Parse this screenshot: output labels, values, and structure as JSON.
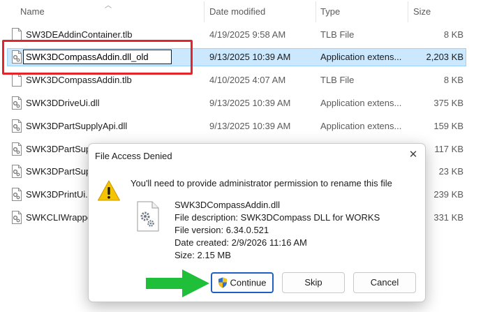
{
  "columns": {
    "name": "Name",
    "date": "Date modified",
    "type": "Type",
    "size": "Size"
  },
  "files": [
    {
      "name": "SW3DEAddinContainer.tlb",
      "date": "4/19/2025 9:58 AM",
      "type": "TLB File",
      "size": "8 KB",
      "icon": "tlb-file-icon"
    },
    {
      "name": "SWK3DCompassAddin.dll_old",
      "date": "9/13/2025 10:39 AM",
      "type": "Application extens...",
      "size": "2,203 KB",
      "icon": "dll-file-icon",
      "selected": true
    },
    {
      "name": "SWK3DCompassAddin.tlb",
      "date": "4/10/2025 4:07 AM",
      "type": "TLB File",
      "size": "8 KB",
      "icon": "tlb-file-icon"
    },
    {
      "name": "SWK3DDriveUi.dll",
      "date": "9/13/2025 10:39 AM",
      "type": "Application extens...",
      "size": "375 KB",
      "icon": "dll-file-icon"
    },
    {
      "name": "SWK3DPartSupplyApi.dll",
      "date": "9/13/2025 10:39 AM",
      "type": "Application extens...",
      "size": "159 KB",
      "icon": "dll-file-icon"
    },
    {
      "name": "SWK3DPartSup",
      "date": "",
      "type": "",
      "size": "117 KB",
      "icon": "dll-file-icon"
    },
    {
      "name": "SWK3DPartSupp",
      "date": "",
      "type": "",
      "size": "23 KB",
      "icon": "dll-file-icon"
    },
    {
      "name": "SWK3DPrintUi.d",
      "date": "",
      "type": "",
      "size": "239 KB",
      "icon": "dll-file-icon"
    },
    {
      "name": "SWKCLIWrappe",
      "date": "",
      "type": "",
      "size": "331 KB",
      "icon": "dll-file-icon"
    }
  ],
  "dialog": {
    "title": "File Access Denied",
    "close_label": "✕",
    "message": "You'll need to provide administrator permission to rename this file",
    "file_name": "SWK3DCompassAddin.dll",
    "description": "File description: SWK3DCompass DLL for WORKS",
    "version": "File version: 6.34.0.521",
    "created": "Date created: 2/9/2026 11:16 AM",
    "size": "Size: 2.15 MB",
    "buttons": {
      "continue": "Continue",
      "skip": "Skip",
      "cancel": "Cancel"
    }
  },
  "colors": {
    "highlight_box": "#e3242b",
    "arrow": "#1fbf3a",
    "selection": "#cce8ff",
    "primary_border": "#1f5fbf"
  }
}
